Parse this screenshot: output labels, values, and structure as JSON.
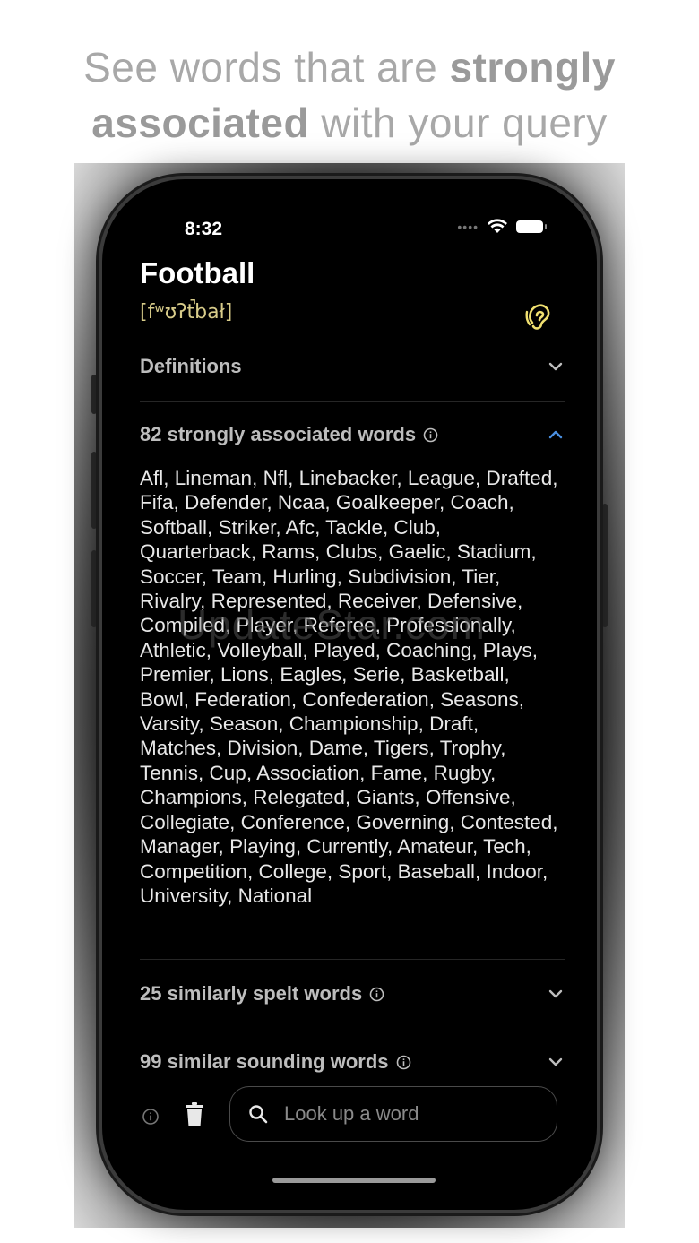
{
  "headline": {
    "part1": "See words that are ",
    "bold1": "strongly",
    "bold2": "associated",
    "part2": " with your query"
  },
  "status": {
    "time": "8:32"
  },
  "word": {
    "title": "Football",
    "phonetic": "[fʷʊʔt̚bał]"
  },
  "sections": {
    "definitions": "Definitions",
    "associated": "82 strongly associated words",
    "spelt": "25 similarly spelt words",
    "sounding": "99 similar sounding words"
  },
  "associated_words": "Afl, Lineman, Nfl, Linebacker, League, Drafted, Fifa, Defender, Ncaa, Goalkeeper, Coach, Softball, Striker, Afc, Tackle, Club, Quarterback, Rams, Clubs, Gaelic, Stadium, Soccer, Team, Hurling, Subdivision, Tier, Rivalry, Represented, Receiver, Defensive, Compiled, Player, Referee, Professionally, Athletic, Volleyball, Played, Coaching, Plays, Premier, Lions, Eagles, Serie, Basketball, Bowl, Federation, Confederation, Seasons, Varsity, Season, Championship, Draft, Matches, Division, Dame, Tigers, Trophy, Tennis, Cup, Association, Fame, Rugby, Champions, Relegated, Giants, Offensive, Collegiate, Conference, Governing, Contested, Manager, Playing, Currently, Amateur, Tech, Competition, College, Sport, Baseball, Indoor, University, National",
  "watermark": "UpdateStar.com",
  "search": {
    "placeholder": "Look up a word"
  },
  "colors": {
    "accent_chevron": "#4a8fe0",
    "phonetic": "#d8cc8a",
    "ear_icon": "#f0e070"
  }
}
